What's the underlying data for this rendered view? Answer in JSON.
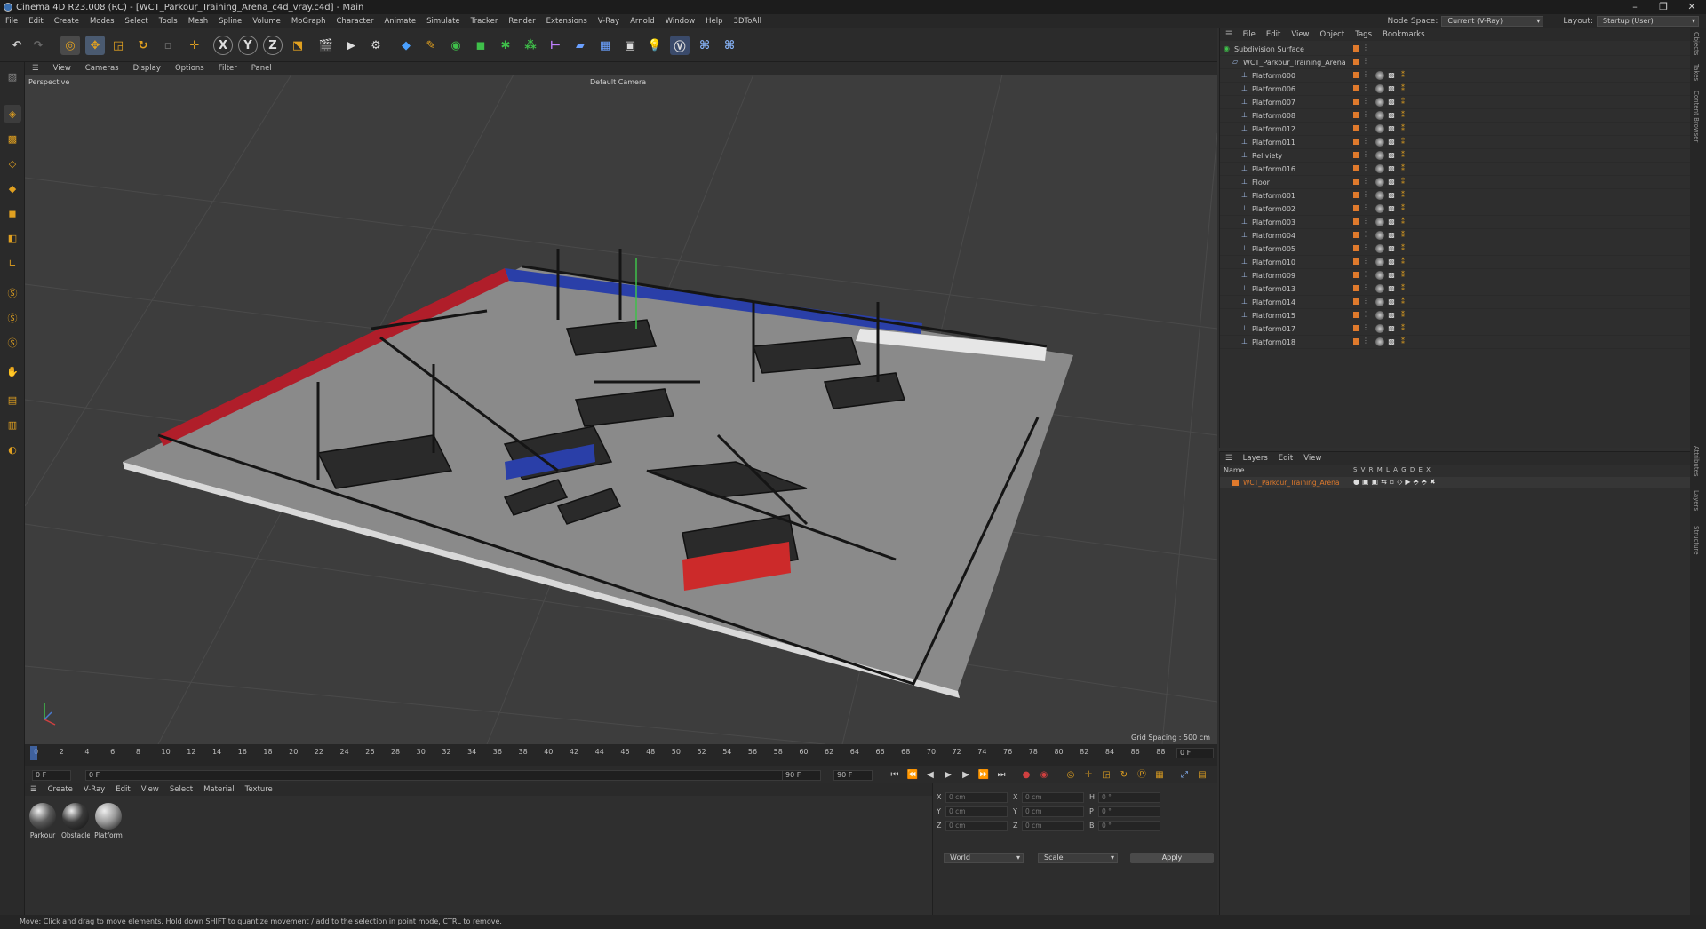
{
  "window": {
    "title": "Cinema 4D R23.008 (RC) - [WCT_Parkour_Training_Arena_c4d_vray.c4d] - Main"
  },
  "menu": [
    "File",
    "Edit",
    "Create",
    "Modes",
    "Select",
    "Tools",
    "Mesh",
    "Spline",
    "Volume",
    "MoGraph",
    "Character",
    "Animate",
    "Simulate",
    "Tracker",
    "Render",
    "Extensions",
    "V-Ray",
    "Arnold",
    "Window",
    "Help",
    "3DToAll"
  ],
  "node_space": {
    "label": "Node Space:",
    "value": "Current (V-Ray)"
  },
  "layout": {
    "label": "Layout:",
    "value": "Startup (User)"
  },
  "viewport": {
    "menu": [
      "View",
      "Cameras",
      "Display",
      "Options",
      "Filter",
      "Panel"
    ],
    "projection": "Perspective",
    "camera": "Default Camera",
    "grid_spacing": "Grid Spacing : 500 cm"
  },
  "timeline": {
    "ticks": [
      "0",
      "2",
      "4",
      "6",
      "8",
      "10",
      "12",
      "14",
      "16",
      "18",
      "20",
      "22",
      "24",
      "26",
      "28",
      "30",
      "32",
      "34",
      "36",
      "38",
      "40",
      "42",
      "44",
      "46",
      "48",
      "50",
      "52",
      "54",
      "56",
      "58",
      "60",
      "62",
      "64",
      "66",
      "68",
      "70",
      "72",
      "74",
      "76",
      "78",
      "80",
      "82",
      "84",
      "86",
      "88",
      "90"
    ],
    "current_frame": "0 F",
    "start": "0 F",
    "end_a": "90 F",
    "end_b": "90 F",
    "right_field": "0 F"
  },
  "material_panel": {
    "menu": [
      "Create",
      "V-Ray",
      "Edit",
      "View",
      "Select",
      "Material",
      "Texture"
    ],
    "materials": [
      {
        "label": "Parkour",
        "color": "#5a5a5a"
      },
      {
        "label": "Obstacle",
        "color": "#3a3a3a"
      },
      {
        "label": "Platform",
        "color": "#9a9a9a"
      }
    ]
  },
  "coordinates": {
    "rows": [
      {
        "a": "X",
        "av": "0 cm",
        "b": "X",
        "bv": "0 cm",
        "c": "H",
        "cv": "0 °"
      },
      {
        "a": "Y",
        "av": "0 cm",
        "b": "Y",
        "bv": "0 cm",
        "c": "P",
        "cv": "0 °"
      },
      {
        "a": "Z",
        "av": "0 cm",
        "b": "Z",
        "bv": "0 cm",
        "c": "B",
        "cv": "0 °"
      }
    ],
    "world": "World",
    "scale": "Scale",
    "apply": "Apply"
  },
  "objects": {
    "menu": [
      "File",
      "Edit",
      "View",
      "Object",
      "Tags",
      "Bookmarks"
    ],
    "root": "Subdivision Surface",
    "group": "WCT_Parkour_Training_Arena",
    "items": [
      "Platform000",
      "Platform006",
      "Platform007",
      "Platform008",
      "Platform012",
      "Platform011",
      "Reliviety",
      "Platform016",
      "Floor",
      "Platform001",
      "Platform002",
      "Platform003",
      "Platform004",
      "Platform005",
      "Platform010",
      "Platform009",
      "Platform013",
      "Platform014",
      "Platform015",
      "Platform017",
      "Platform018"
    ]
  },
  "layers": {
    "menu": [
      "Layers",
      "Edit",
      "View"
    ],
    "header_name": "Name",
    "header_cols": "S V R M L A G D E X",
    "items": [
      "WCT_Parkour_Training_Arena"
    ]
  },
  "status": "Move: Click and drag to move elements. Hold down SHIFT to quantize movement / add to the selection in point mode, CTRL to remove.",
  "right_tabs": [
    "Objects",
    "Takes",
    "Content Browser",
    "Attributes",
    "Layers",
    "Structure"
  ]
}
